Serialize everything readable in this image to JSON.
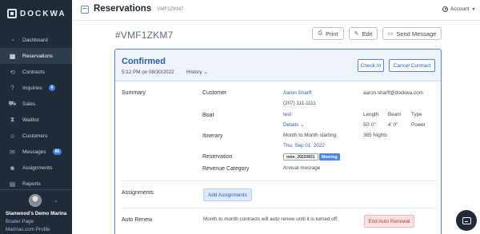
{
  "app": {
    "brand": "DOCKWA"
  },
  "sidebar": {
    "items": [
      {
        "label": "Dashboard",
        "icon": "dashboard-icon"
      },
      {
        "label": "Reservations",
        "icon": "calendar-icon",
        "active": true
      },
      {
        "label": "Contracts",
        "icon": "contracts-icon"
      },
      {
        "label": "Inquiries",
        "icon": "question-icon",
        "badge": "6"
      },
      {
        "label": "Sales",
        "icon": "cart-icon"
      },
      {
        "label": "Waitlist",
        "icon": "waitlist-icon"
      },
      {
        "label": "Customers",
        "icon": "customers-icon"
      },
      {
        "label": "Messages",
        "icon": "mail-icon",
        "badge": "86"
      },
      {
        "label": "Assignments",
        "icon": "person-icon"
      },
      {
        "label": "Reports",
        "icon": "reports-icon"
      }
    ],
    "marina_name": "Stanwood's Demo Marina",
    "boater_page": "Boater Page",
    "marinas_profile": "Marinas.com Profile"
  },
  "header": {
    "title": "Reservations",
    "breadcrumb": "VMF1ZKM7",
    "account": "Account"
  },
  "reservation": {
    "id": "#VMF1ZKM7",
    "buttons": {
      "print": "Print",
      "edit": "Edit",
      "send": "Send Message"
    },
    "status": "Confirmed",
    "status_date": "5:12 PM on 08/30/2022",
    "history": "History",
    "check_in": "Check In",
    "cancel_contract": "Cancel Contract",
    "summary_label": "Summary",
    "customer": {
      "label": "Customer",
      "name": "Aaron Sharff",
      "phone": "(207) 111-1111",
      "email": "aaron.sharff@dockwa.com"
    },
    "boat": {
      "label": "Boat",
      "name": "test",
      "details": "Details",
      "length_label": "Length",
      "beam_label": "Beam",
      "type_label": "Type",
      "length": "50' 0\"",
      "beam": "4' 0\"",
      "type": "Power"
    },
    "itinerary": {
      "label": "Itinerary",
      "line1": "Month to Month starting:",
      "date": "Thu, Sep 01, 2022",
      "nights": "365 Nights"
    },
    "reservation_row": {
      "label": "Reservation",
      "code": "mtm_20220831",
      "tag": "Mooring"
    },
    "revenue": {
      "label": "Revenue Category",
      "value": "Annual moorage"
    },
    "assignments": {
      "label": "Assignments",
      "button": "Add Assignments"
    },
    "auto_renew": {
      "label": "Auto Renew",
      "text": "Month to month contracts will auto renew until it is turned off.",
      "button": "End Auto Renewal"
    }
  },
  "colors": {
    "accent": "#4a86e8",
    "sidebar": "#1f2b38",
    "danger": "#c0392b"
  }
}
